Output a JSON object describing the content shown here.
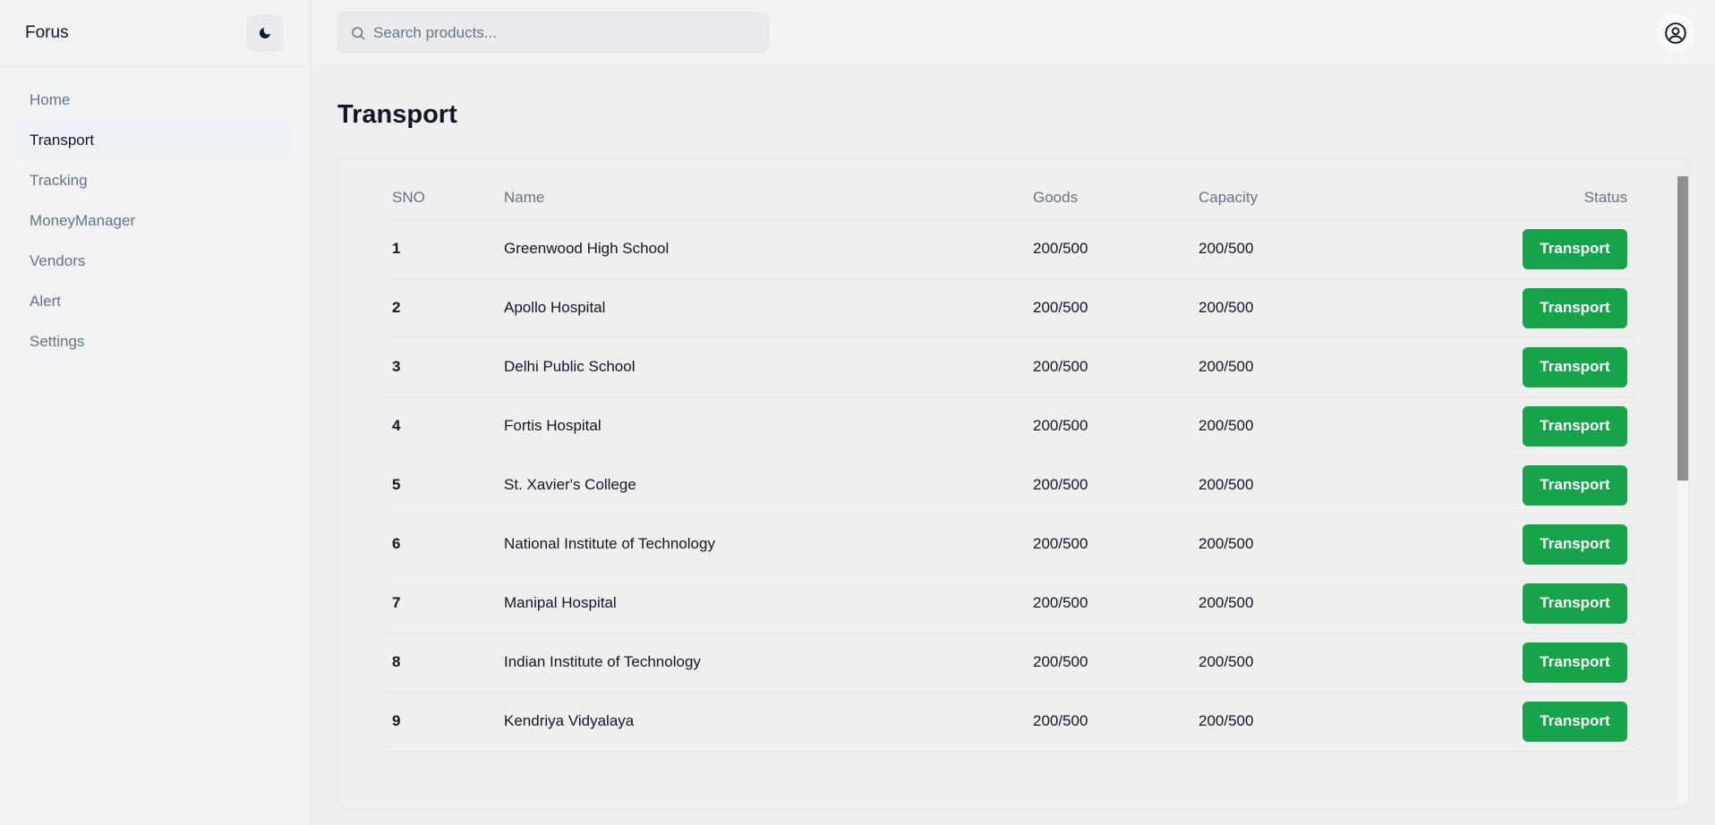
{
  "brand": "Forus",
  "sidebar": {
    "items": [
      {
        "label": "Home"
      },
      {
        "label": "Transport"
      },
      {
        "label": "Tracking"
      },
      {
        "label": "MoneyManager"
      },
      {
        "label": "Vendors"
      },
      {
        "label": "Alert"
      },
      {
        "label": "Settings"
      }
    ],
    "active": "Transport"
  },
  "search": {
    "placeholder": "Search products..."
  },
  "page": {
    "title": "Transport"
  },
  "table": {
    "headers": {
      "sno": "SNO",
      "name": "Name",
      "goods": "Goods",
      "capacity": "Capacity",
      "status": "Status"
    },
    "rows": [
      {
        "sno": "1",
        "name": "Greenwood High School",
        "goods": "200/500",
        "capacity": "200/500",
        "status": "Transport"
      },
      {
        "sno": "2",
        "name": "Apollo Hospital",
        "goods": "200/500",
        "capacity": "200/500",
        "status": "Transport"
      },
      {
        "sno": "3",
        "name": "Delhi Public School",
        "goods": "200/500",
        "capacity": "200/500",
        "status": "Transport"
      },
      {
        "sno": "4",
        "name": "Fortis Hospital",
        "goods": "200/500",
        "capacity": "200/500",
        "status": "Transport"
      },
      {
        "sno": "5",
        "name": "St. Xavier's College",
        "goods": "200/500",
        "capacity": "200/500",
        "status": "Transport"
      },
      {
        "sno": "6",
        "name": "National Institute of Technology",
        "goods": "200/500",
        "capacity": "200/500",
        "status": "Transport"
      },
      {
        "sno": "7",
        "name": "Manipal Hospital",
        "goods": "200/500",
        "capacity": "200/500",
        "status": "Transport"
      },
      {
        "sno": "8",
        "name": "Indian Institute of Technology",
        "goods": "200/500",
        "capacity": "200/500",
        "status": "Transport"
      },
      {
        "sno": "9",
        "name": "Kendriya Vidyalaya",
        "goods": "200/500",
        "capacity": "200/500",
        "status": "Transport"
      }
    ]
  },
  "icons": {
    "theme": "moon-icon",
    "search": "search-icon",
    "account": "user-circle-icon"
  },
  "colors": {
    "accent": "#16a34a",
    "muted": "#64748b",
    "text": "#0f172a"
  }
}
